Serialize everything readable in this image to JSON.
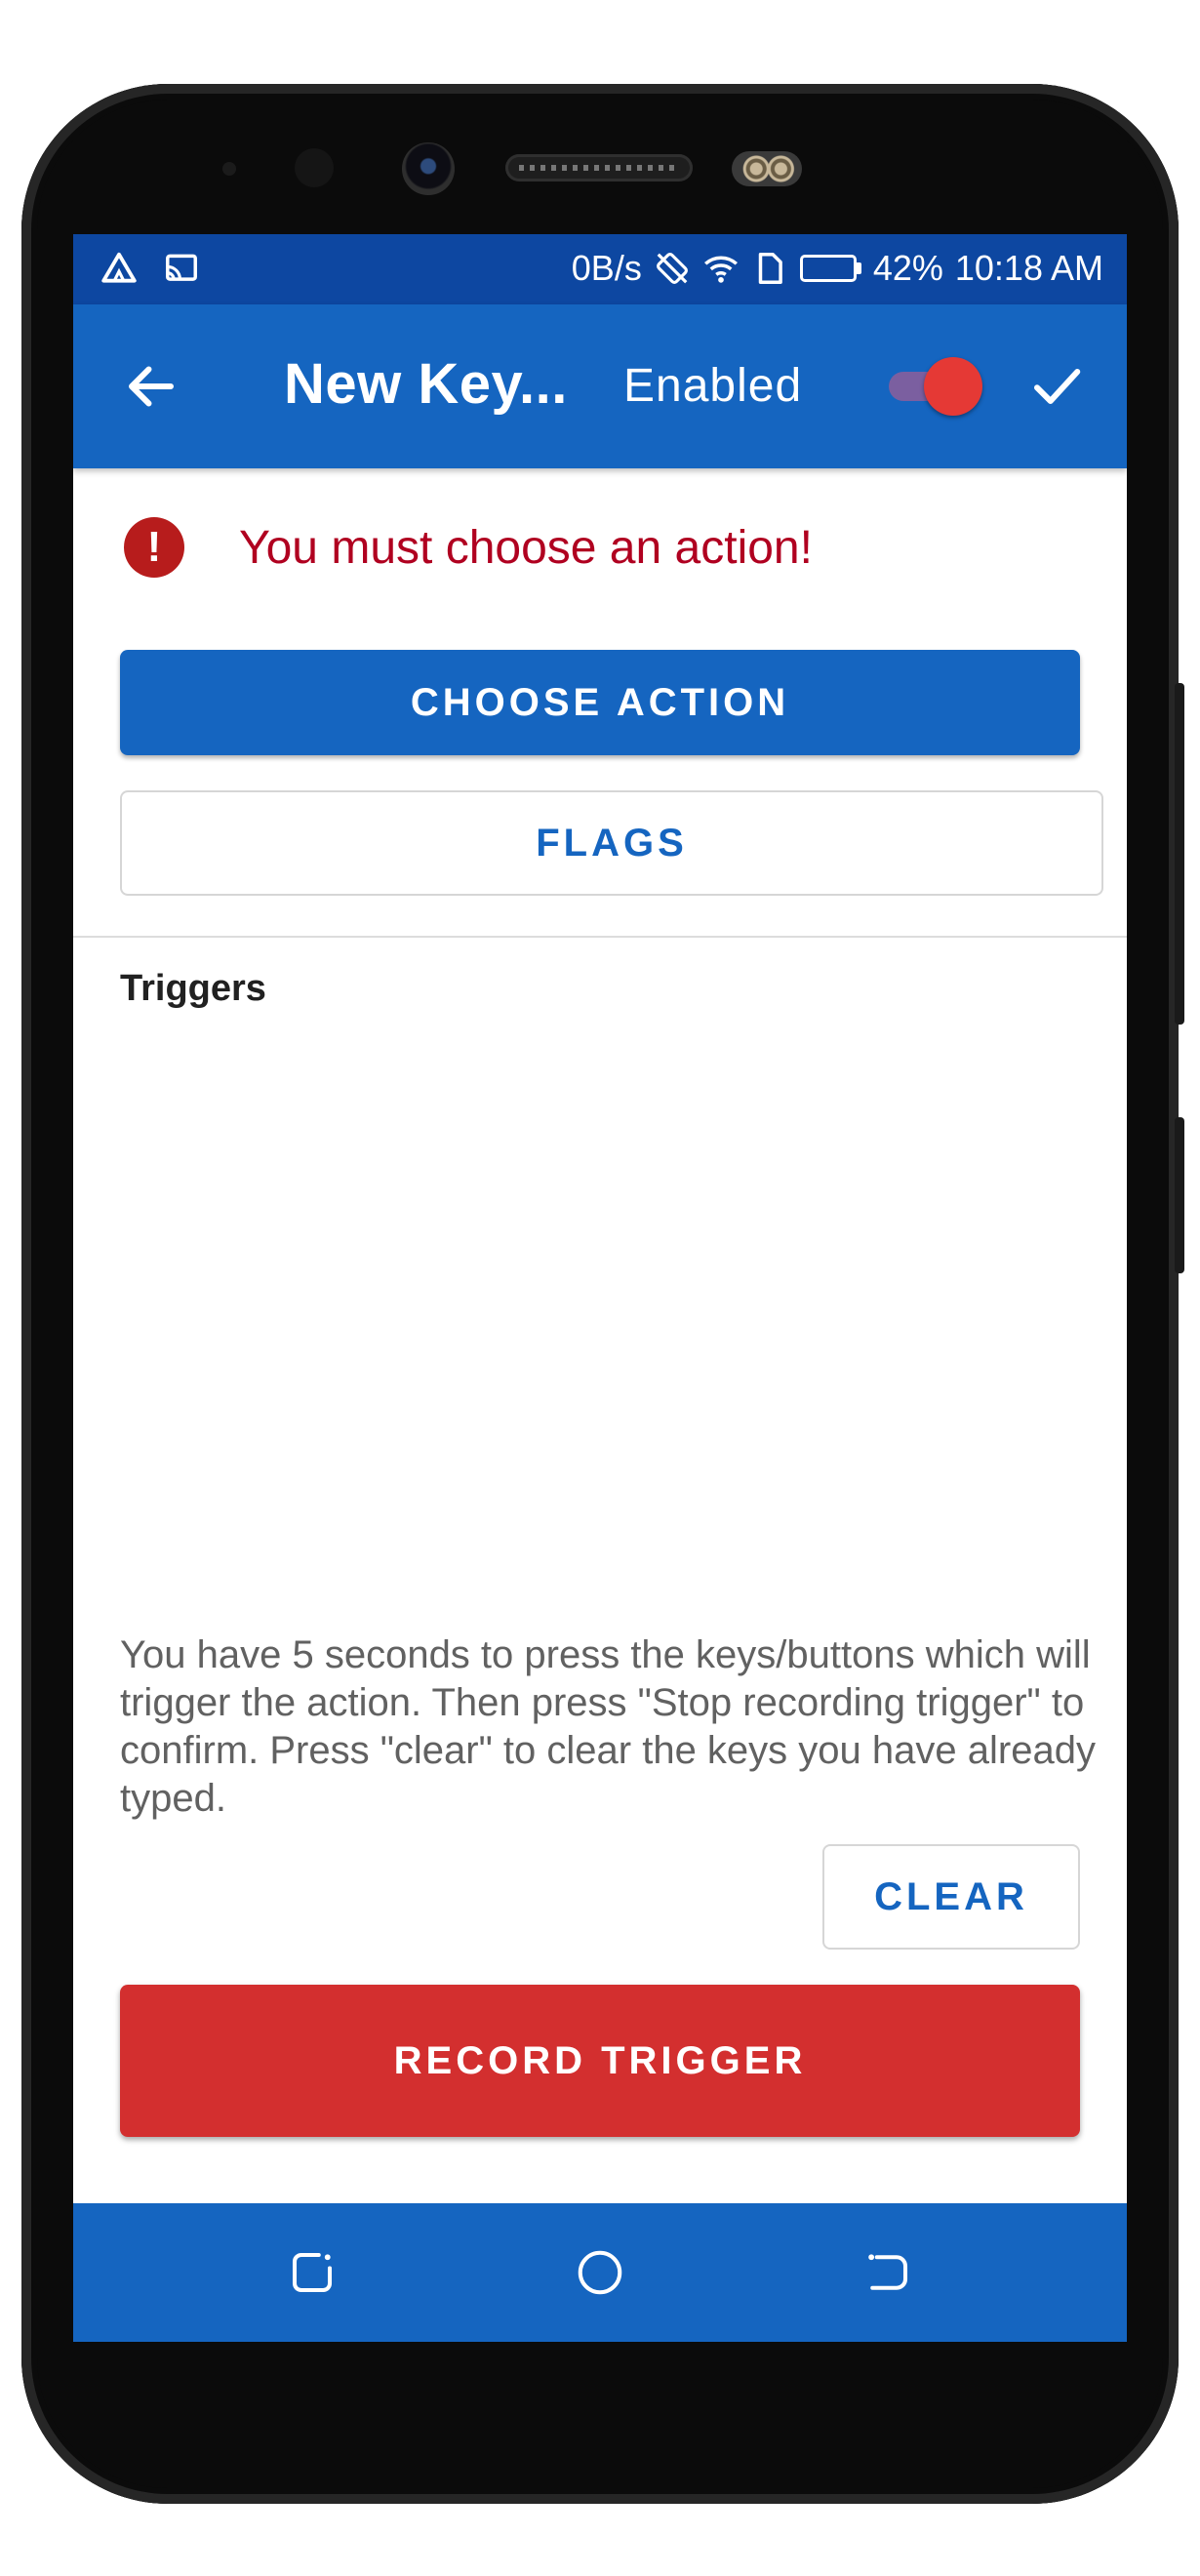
{
  "status_bar": {
    "left_icons": [
      "warning-triangle-icon",
      "cast-screen-icon"
    ],
    "net_speed": "0B/s",
    "right_icons": [
      "rotation-off-icon",
      "wifi-icon",
      "sim-card-icon"
    ],
    "battery_level": 0.42,
    "battery_text": "42%",
    "time": "10:18 AM",
    "color": "#0d47a1"
  },
  "appbar": {
    "title": "New Key...",
    "enabled_label": "Enabled",
    "enabled_on": true,
    "back_icon": "arrow-back-icon",
    "confirm_icon": "check-icon",
    "color": "#1565c0"
  },
  "error": {
    "icon": "error-exclamation-icon",
    "icon_glyph": "!",
    "text": "You must choose an action!",
    "color": "#b00020"
  },
  "buttons": {
    "choose_action": "CHOOSE ACTION",
    "flags": "FLAGS",
    "clear": "CLEAR",
    "record_trigger": "RECORD TRIGGER"
  },
  "triggers": {
    "label": "Triggers",
    "instructions": "You have 5 seconds to press the keys/buttons which will trigger the action. Then press \"Stop recording trigger\" to confirm. Press \"clear\" to clear the keys you have already typed."
  },
  "colors": {
    "primary": "#1565c0",
    "record": "#d32f2f"
  },
  "nav_bar": {
    "icons": [
      "recent-apps-icon",
      "home-circle-icon",
      "back-nav-icon"
    ]
  }
}
